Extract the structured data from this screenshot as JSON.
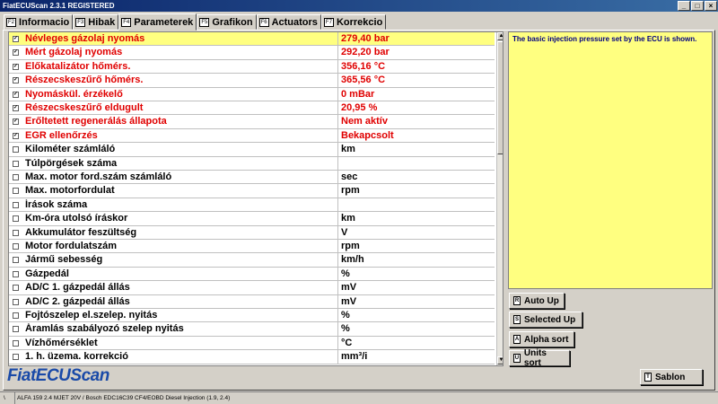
{
  "window": {
    "title": "FiatECUScan 2.3.1 REGISTERED",
    "controls": [
      "_",
      "□",
      "×"
    ]
  },
  "tabs": [
    {
      "key": "F2",
      "label": "Informacio",
      "active": false
    },
    {
      "key": "F3",
      "label": "Hibak",
      "active": false
    },
    {
      "key": "F4",
      "label": "Parameterek",
      "active": true
    },
    {
      "key": "F5",
      "label": "Grafikon",
      "active": false
    },
    {
      "key": "F6",
      "label": "Actuators",
      "active": false
    },
    {
      "key": "F7",
      "label": "Korrekcio",
      "active": false
    }
  ],
  "parameters": [
    {
      "name": "Névleges gázolaj nyomás",
      "value": "279,40 bar",
      "checked": true,
      "highlighted": true
    },
    {
      "name": "Mért gázolaj nyomás",
      "value": "292,20 bar",
      "checked": true,
      "highlighted": false
    },
    {
      "name": "Előkatalizátor hőmérs.",
      "value": "356,16 °C",
      "checked": true,
      "highlighted": false
    },
    {
      "name": "Részecskeszűrő hőmérs.",
      "value": "365,56 °C",
      "checked": true,
      "highlighted": false
    },
    {
      "name": "Nyomáskül. érzékelő",
      "value": "0 mBar",
      "checked": true,
      "highlighted": false
    },
    {
      "name": "Részecskeszűrő eldugult",
      "value": "20,95 %",
      "checked": true,
      "highlighted": false
    },
    {
      "name": "Erőltetett regenerálás állapota",
      "value": "Nem aktív",
      "checked": true,
      "highlighted": false
    },
    {
      "name": "EGR ellenőrzés",
      "value": "Bekapcsolt",
      "checked": true,
      "highlighted": false
    },
    {
      "name": "Kilométer számláló",
      "value": " km",
      "checked": false,
      "highlighted": false
    },
    {
      "name": "Túlpörgések száma",
      "value": "",
      "checked": false,
      "highlighted": false
    },
    {
      "name": "Max. motor ford.szám számláló",
      "value": " sec",
      "checked": false,
      "highlighted": false
    },
    {
      "name": "Max. motorfordulat",
      "value": " rpm",
      "checked": false,
      "highlighted": false
    },
    {
      "name": "Írások száma",
      "value": "",
      "checked": false,
      "highlighted": false
    },
    {
      "name": "Km-óra utolsó íráskor",
      "value": " km",
      "checked": false,
      "highlighted": false
    },
    {
      "name": "Akkumulátor feszültség",
      "value": " V",
      "checked": false,
      "highlighted": false
    },
    {
      "name": "Motor fordulatszám",
      "value": " rpm",
      "checked": false,
      "highlighted": false
    },
    {
      "name": "Jármű sebesség",
      "value": " km/h",
      "checked": false,
      "highlighted": false
    },
    {
      "name": "Gázpedál",
      "value": " %",
      "checked": false,
      "highlighted": false
    },
    {
      "name": "AD/C 1. gázpedál állás",
      "value": " mV",
      "checked": false,
      "highlighted": false
    },
    {
      "name": "AD/C 2. gázpedál állás",
      "value": " mV",
      "checked": false,
      "highlighted": false
    },
    {
      "name": "Fojtószelep el.szelep. nyitás",
      "value": " %",
      "checked": false,
      "highlighted": false
    },
    {
      "name": "Áramlás szabályozó szelep nyitás",
      "value": " %",
      "checked": false,
      "highlighted": false
    },
    {
      "name": "Vízhőmérséklet",
      "value": " °C",
      "checked": false,
      "highlighted": false
    },
    {
      "name": "1. h. üzema. korrekció",
      "value": " mm³/i",
      "checked": false,
      "highlighted": false
    }
  ],
  "colors": {
    "active_param": "#e00000",
    "inactive_param": "#000000",
    "highlight": "#ffff80",
    "logo": "#1a4aa8"
  },
  "description": "The basic injection pressure set by the ECU is shown.",
  "side_buttons": [
    {
      "key": "R",
      "label": "Auto Up"
    },
    {
      "key": "S",
      "label": "Selected Up"
    },
    {
      "key": "A",
      "label": "Alpha sort"
    },
    {
      "key": "U",
      "label": "Units sort"
    }
  ],
  "template_button": {
    "key": "T",
    "label": "Sablon"
  },
  "logo": "FiatECUScan",
  "status": {
    "prefix": "\\",
    "text": "ALFA 159 2.4 MJET 20V / Bosch EDC16C39 CF4/EOBD Diesel Injection (1.9, 2.4)"
  }
}
